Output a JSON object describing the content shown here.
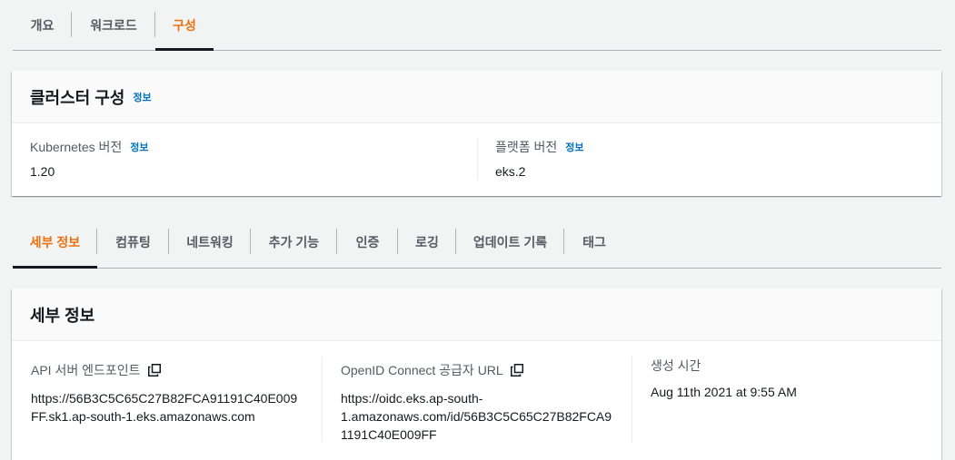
{
  "top_tabs": [
    {
      "label": "개요",
      "active": false
    },
    {
      "label": "워크로드",
      "active": false
    },
    {
      "label": "구성",
      "active": true
    }
  ],
  "cluster_config": {
    "title": "클러스터 구성",
    "info": "정보",
    "kubernetes_version_label": "Kubernetes 버전",
    "kubernetes_version_info": "정보",
    "kubernetes_version": "1.20",
    "platform_version_label": "플랫폼 버전",
    "platform_version_info": "정보",
    "platform_version": "eks.2"
  },
  "sub_tabs": [
    {
      "label": "세부 정보",
      "active": true
    },
    {
      "label": "컴퓨팅",
      "active": false
    },
    {
      "label": "네트워킹",
      "active": false
    },
    {
      "label": "추가 기능",
      "active": false
    },
    {
      "label": "인증",
      "active": false
    },
    {
      "label": "로깅",
      "active": false
    },
    {
      "label": "업데이트 기록",
      "active": false
    },
    {
      "label": "태그",
      "active": false
    }
  ],
  "details": {
    "title": "세부 정보",
    "api_endpoint_label": "API 서버 엔드포인트",
    "api_endpoint_line1": "https://56B3C5C65C27B82FCA91191C40E009",
    "api_endpoint_line2": "FF.sk1.ap-south-1.eks.amazonaws.com",
    "oidc_label": "OpenID Connect 공급자 URL",
    "oidc_line1": "https://oidc.eks.ap-south-",
    "oidc_line2": "1.amazonaws.com/id/56B3C5C65C27B82FCA9",
    "oidc_line3": "1191C40E009FF",
    "created_label": "생성 시간",
    "created_value": "Aug 11th 2021 at 9:55 AM"
  },
  "colors": {
    "accent": "#ec7211",
    "link": "#0073bb",
    "text": "#16191f",
    "secondary_text": "#545b64"
  },
  "icons": [
    "copy-icon"
  ]
}
